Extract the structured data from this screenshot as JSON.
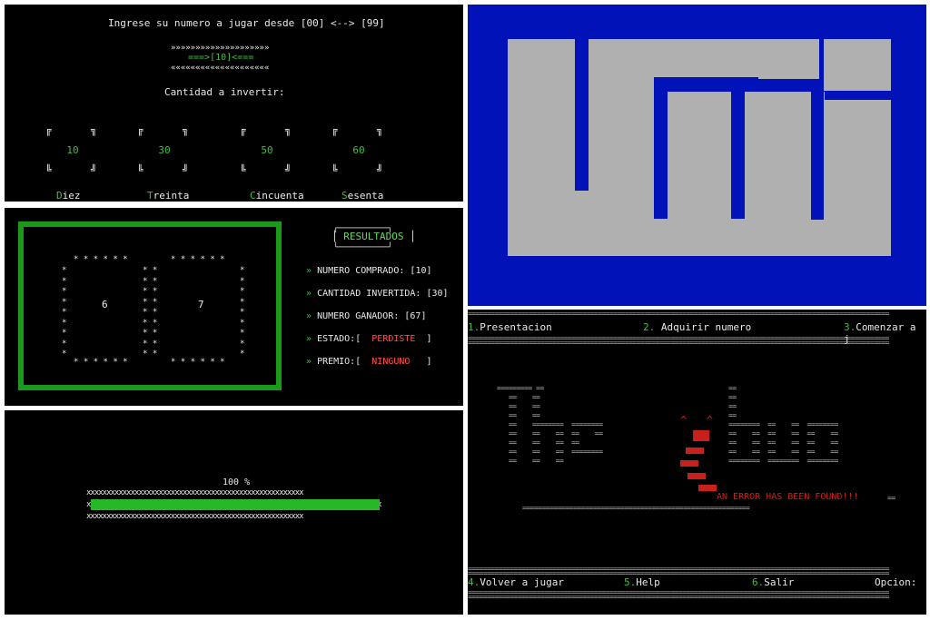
{
  "bet_screen": {
    "prompt": "Ingrese su numero a jugar desde [00] <--> [99]",
    "arrows_top": "»»»»»»»»»»»»»»»»»»»»",
    "selected_number": "===>[10]<===",
    "arrows_bottom": "««««««««««««««««««««",
    "amount_prompt": "Cantidad a invertir:",
    "options": [
      {
        "value": "10",
        "hotkey": "D",
        "rest": "iez"
      },
      {
        "value": "30",
        "hotkey": "T",
        "rest": "reinta"
      },
      {
        "value": "50",
        "hotkey": "C",
        "rest": "incuenta"
      },
      {
        "value": "60",
        "hotkey": "S",
        "rest": "esenta"
      }
    ]
  },
  "results_screen": {
    "left_digit": "6",
    "right_digit": "7",
    "title": "RESULTADOS",
    "rows": [
      {
        "label": "NUMERO COMPRADO: ",
        "value": "[10]"
      },
      {
        "label": "CANTIDAD INVERTIDA: ",
        "value": "[30]"
      },
      {
        "label": "NUMERO GANADOR: ",
        "value": "[67]"
      }
    ],
    "estado_label": "ESTADO:[",
    "estado_value": "PERDISTE",
    "premio_label": "PREMIO:[",
    "premio_value": "NINGUNO",
    "close_bracket": "]",
    "bullet": "»"
  },
  "loading_screen": {
    "percent_text": "100 %",
    "progress": 1.0
  },
  "logo_screen": {
    "bg_color": "#0012b8",
    "fg_color": "#b0b0b0"
  },
  "error_screen": {
    "menu_top": [
      {
        "num": "1.",
        "label": "Presentacion"
      },
      {
        "num": "2.",
        "label": " Adquirir numero"
      },
      {
        "num": "3.",
        "label": "Comenzar a j"
      }
    ],
    "error_text": "AN ERROR HAS BEEN FOUND!!!",
    "menu_bottom": [
      {
        "num": "4.",
        "label": "Volver a jugar"
      },
      {
        "num": "5.",
        "label": "Help"
      },
      {
        "num": "6.",
        "label": "Salir"
      }
    ],
    "option_label": "Opcion:"
  },
  "colors": {
    "green": "#3fbf3f",
    "red": "#ff5050",
    "frame_green": "#1a9a1a"
  }
}
